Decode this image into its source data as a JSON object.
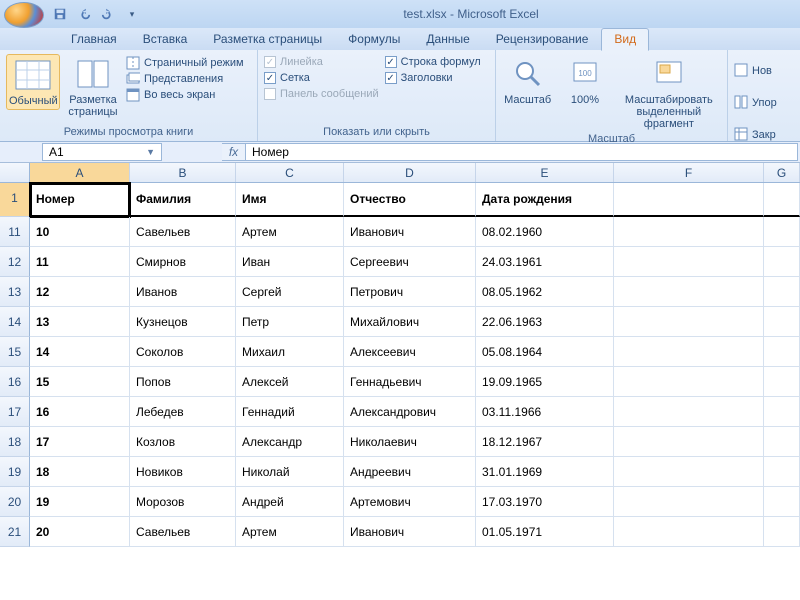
{
  "title": "test.xlsx - Microsoft Excel",
  "tabs": [
    "Главная",
    "Вставка",
    "Разметка страницы",
    "Формулы",
    "Данные",
    "Рецензирование",
    "Вид"
  ],
  "active_tab": 6,
  "ribbon": {
    "group_views": {
      "label": "Режимы просмотра книги",
      "normal": "Обычный",
      "page_layout": "Разметка страницы",
      "page_break": "Страничный режим",
      "custom_views": "Представления",
      "full_screen": "Во весь экран"
    },
    "group_show": {
      "label": "Показать или скрыть",
      "ruler": "Линейка",
      "gridlines": "Сетка",
      "message_bar": "Панель сообщений",
      "formula_bar": "Строка формул",
      "headings": "Заголовки"
    },
    "group_zoom": {
      "label": "Масштаб",
      "zoom": "Масштаб",
      "z100": "100%",
      "zoom_selection": "Масштабировать выделенный фрагмент"
    },
    "group_window": {
      "new": "Нов",
      "arrange": "Упор",
      "freeze": "Закр"
    }
  },
  "namebox": "A1",
  "formula": "Номер",
  "columns": [
    "A",
    "B",
    "C",
    "D",
    "E",
    "F",
    "G"
  ],
  "header_row_num": "1",
  "headers": [
    "Номер",
    "Фамилия",
    "Имя",
    "Отчество",
    "Дата рождения"
  ],
  "rows": [
    {
      "n": "11",
      "c": [
        "10",
        "Савельев",
        "Артем",
        "Иванович",
        "08.02.1960"
      ]
    },
    {
      "n": "12",
      "c": [
        "11",
        "Смирнов",
        "Иван",
        "Сергеевич",
        "24.03.1961"
      ]
    },
    {
      "n": "13",
      "c": [
        "12",
        "Иванов",
        "Сергей",
        "Петрович",
        "08.05.1962"
      ]
    },
    {
      "n": "14",
      "c": [
        "13",
        "Кузнецов",
        "Петр",
        "Михайлович",
        "22.06.1963"
      ]
    },
    {
      "n": "15",
      "c": [
        "14",
        "Соколов",
        "Михаил",
        "Алексеевич",
        "05.08.1964"
      ]
    },
    {
      "n": "16",
      "c": [
        "15",
        "Попов",
        "Алексей",
        "Геннадьевич",
        "19.09.1965"
      ]
    },
    {
      "n": "17",
      "c": [
        "16",
        "Лебедев",
        "Геннадий",
        "Александрович",
        "03.11.1966"
      ]
    },
    {
      "n": "18",
      "c": [
        "17",
        "Козлов",
        "Александр",
        "Николаевич",
        "18.12.1967"
      ]
    },
    {
      "n": "19",
      "c": [
        "18",
        "Новиков",
        "Николай",
        "Андреевич",
        "31.01.1969"
      ]
    },
    {
      "n": "20",
      "c": [
        "19",
        "Морозов",
        "Андрей",
        "Артемович",
        "17.03.1970"
      ]
    },
    {
      "n": "21",
      "c": [
        "20",
        "Савельев",
        "Артем",
        "Иванович",
        "01.05.1971"
      ]
    }
  ]
}
